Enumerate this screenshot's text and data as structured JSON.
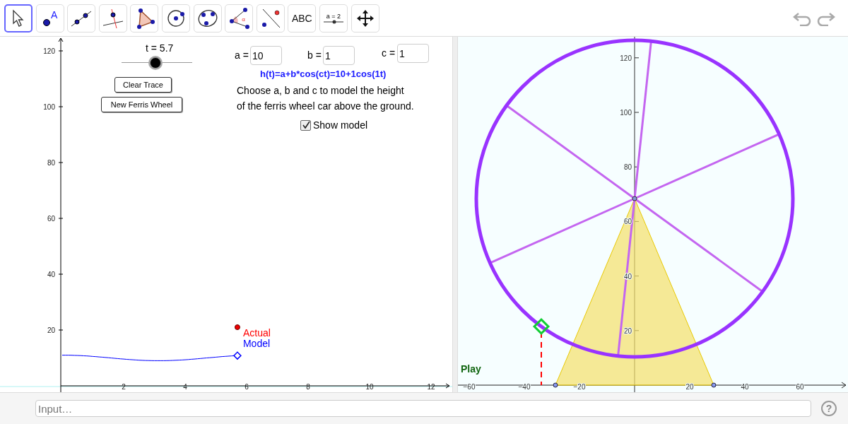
{
  "toolbar": {
    "tools": [
      {
        "kind": "pointer",
        "selected": true
      },
      {
        "kind": "point",
        "label": "A",
        "selected": false
      },
      {
        "kind": "line",
        "selected": false
      },
      {
        "kind": "perpendicular",
        "selected": false
      },
      {
        "kind": "polygon",
        "selected": false
      },
      {
        "kind": "circle",
        "selected": false
      },
      {
        "kind": "ellipse",
        "selected": false
      },
      {
        "kind": "angle",
        "label": "α",
        "selected": false
      },
      {
        "kind": "reflect",
        "selected": false
      },
      {
        "kind": "text",
        "label": "ABC",
        "selected": false
      },
      {
        "kind": "slider",
        "label": "a = 2",
        "selected": false
      },
      {
        "kind": "move",
        "selected": false
      }
    ]
  },
  "graph": {
    "slider": {
      "label": "t = 5.7",
      "level": 0.48
    },
    "buttons": [
      "Clear Trace",
      "New Ferris Wheel"
    ],
    "params": [
      {
        "label": "a =",
        "value": "10"
      },
      {
        "label": "b =",
        "value": "1"
      },
      {
        "label": "c =",
        "value": "1"
      }
    ],
    "formula": "h(t)=a+b*cos(ct)=10+1cos(1t)",
    "instructions": [
      "Choose a, b and c to model the height",
      "of the ferris wheel car above the ground."
    ],
    "show_model": {
      "label": "Show model",
      "checked": true
    },
    "xticks": [
      "2",
      "4",
      "6",
      "8",
      "10",
      "12"
    ],
    "yticks": [
      "120",
      "100",
      "80",
      "60",
      "40",
      "20"
    ],
    "point_labels": [
      "Actual",
      "Model"
    ]
  },
  "wheel_view": {
    "play_label": "Play",
    "xticks": [
      "−60",
      "−40",
      "−20",
      "20",
      "40",
      "60"
    ],
    "yticks": [
      "120",
      "100",
      "80",
      "60",
      "40",
      "20"
    ]
  },
  "input_bar": {
    "placeholder": "Input…",
    "help_label": "?"
  }
}
